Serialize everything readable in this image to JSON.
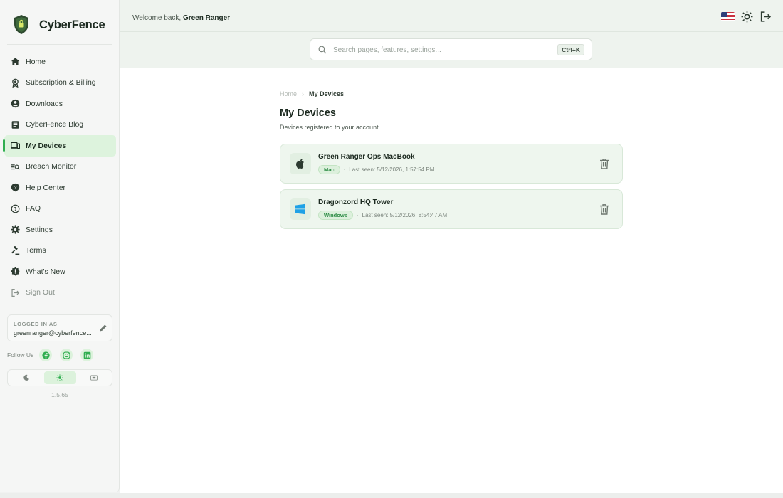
{
  "app": {
    "name": "CyberFence",
    "colors": {
      "accent": "#2fae4f",
      "active_bg": "#ddf3dd",
      "card_bg": "#eef6ee"
    }
  },
  "sidebar": {
    "items": [
      {
        "label": "Home",
        "icon": "home-icon"
      },
      {
        "label": "Subscription & Billing",
        "icon": "badge-icon"
      },
      {
        "label": "Downloads",
        "icon": "download-icon"
      },
      {
        "label": "CyberFence Blog",
        "icon": "blog-icon"
      },
      {
        "label": "My Devices",
        "icon": "devices-icon",
        "active": true
      },
      {
        "label": "Breach Monitor",
        "icon": "breach-monitor-icon"
      },
      {
        "label": "Help Center",
        "icon": "help-icon"
      },
      {
        "label": "FAQ",
        "icon": "faq-icon"
      },
      {
        "label": "Settings",
        "icon": "gear-icon"
      },
      {
        "label": "Terms",
        "icon": "gavel-icon"
      },
      {
        "label": "What's New",
        "icon": "new-badge-icon"
      },
      {
        "label": "Sign Out",
        "icon": "sign-out-icon"
      }
    ],
    "account": {
      "label": "LOGGED IN AS",
      "email": "greenranger@cyberfence..."
    },
    "follow_label": "Follow Us",
    "socials": [
      "facebook-icon",
      "instagram-icon",
      "linkedin-icon"
    ],
    "theme_modes": [
      "dark",
      "light",
      "system"
    ],
    "theme_selected": "light",
    "version": "1.5.65"
  },
  "topbar": {
    "welcome_prefix": "Welcome back, ",
    "user_name": "Green Ranger"
  },
  "search": {
    "placeholder": "Search pages, features, settings...",
    "value": "",
    "shortcut": "Ctrl+K"
  },
  "breadcrumb": {
    "home": "Home",
    "current": "My Devices"
  },
  "page": {
    "title": "My Devices",
    "subtitle": "Devices registered to your account"
  },
  "devices": [
    {
      "name": "Green Ranger Ops MacBook",
      "platform": "Mac",
      "last_seen": "Last seen: 5/12/2026, 1:57:54 PM",
      "icon": "apple-icon"
    },
    {
      "name": "Dragonzord HQ Tower",
      "platform": "Windows",
      "last_seen": "Last seen: 5/12/2026, 8:54:47 AM",
      "icon": "windows-icon"
    }
  ]
}
